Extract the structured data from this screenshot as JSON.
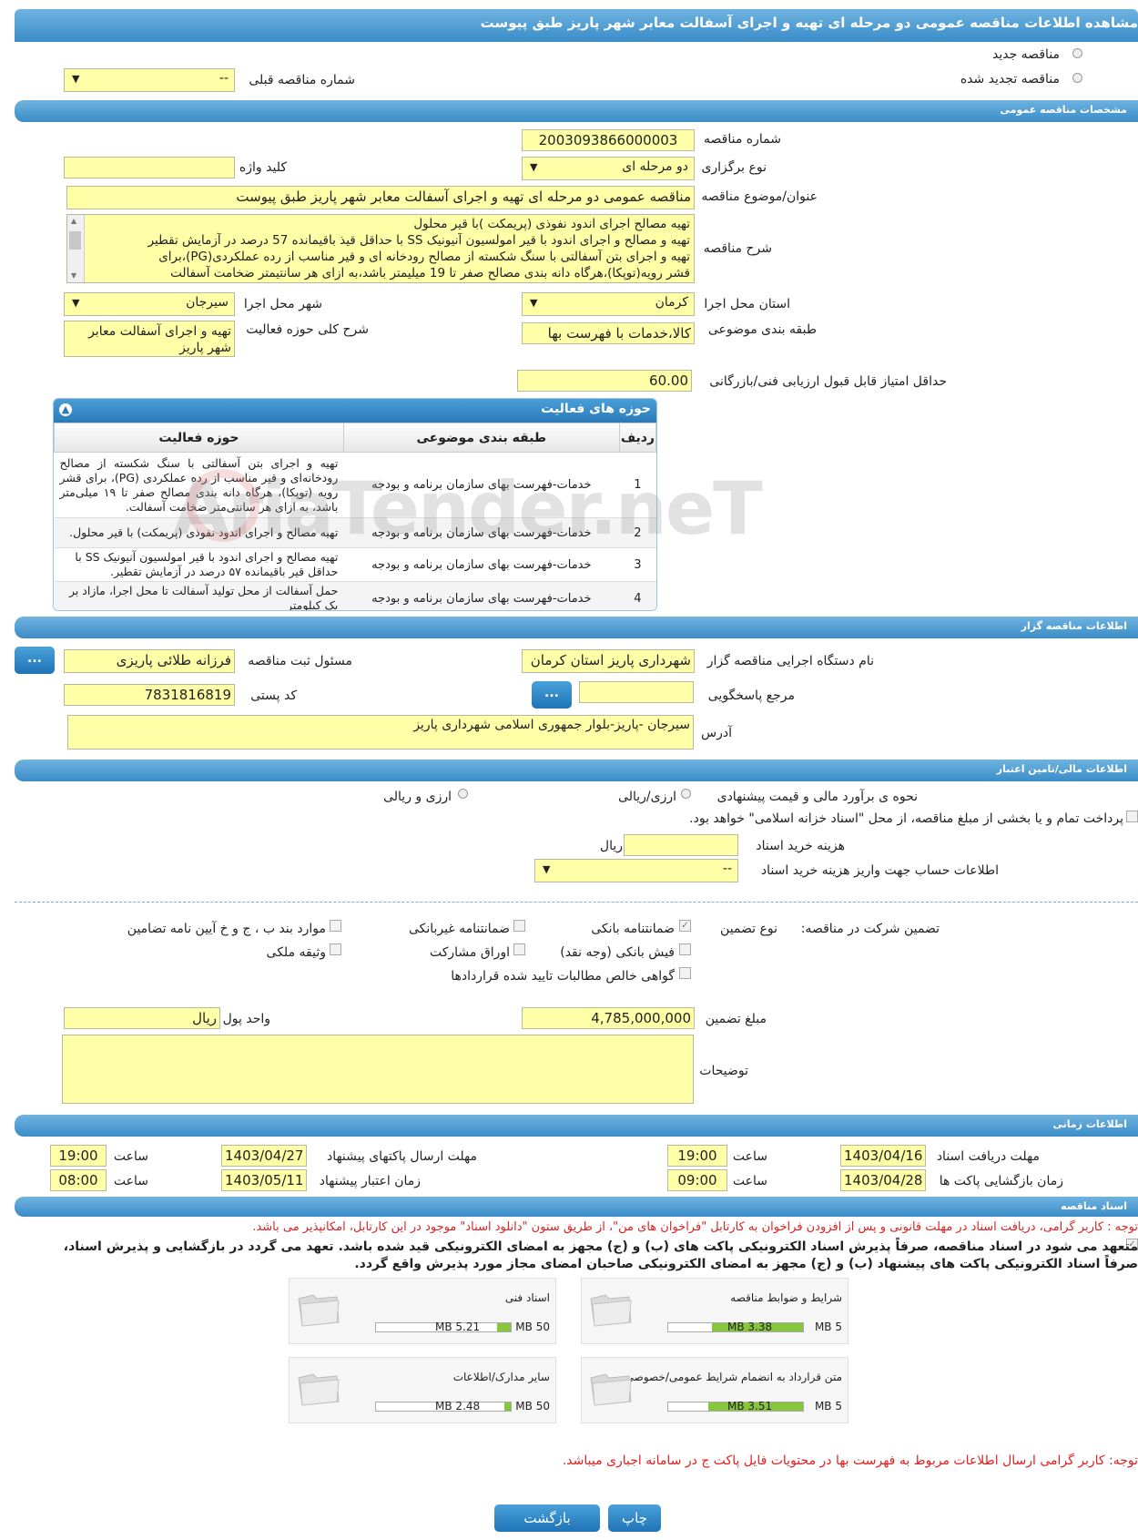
{
  "header_title": "مشاهده اطلاعات مناقصه عمومی دو مرحله ای تهیه و اجرای آسفالت معابر شهر پاریز طبق پیوست",
  "tender_type": {
    "new_label": "مناقصه جدید",
    "renewed_label": "مناقصه تجدید شده",
    "prev_number_label": "شماره مناقصه قبلی",
    "prev_number_value": "--"
  },
  "general": {
    "section_title": "مشخصات مناقصه عمومی",
    "tender_number_label": "شماره مناقصه",
    "tender_number": "2003093866000003",
    "holding_type_label": "نوع برگزاری",
    "holding_type": "دو مرحله ای",
    "keyword_label": "کلید واژه",
    "keyword": "",
    "subject_label": "عنوان/موضوع مناقصه",
    "subject": "مناقصه عمومی دو مرحله ای تهیه و اجرای آسفالت معابر شهر پاریز طبق پیوست",
    "description_label": "شرح مناقصه",
    "description_lines": [
      "تهیه مصالح   اجرای اندود نفوذی (پریمکت )با قیر محلول",
      "تهیه و مصالح و اجرای اندود با قیر امولسیون آنیونیک SS با حداقل قیذ باقیمانده 57 درصد در آزمایش تقطیر",
      "تهیه و اجرای بتن آسفالتی با سنگ شکسته از مصالح رودخانه ای و قیر مناسب از رده عملکردی(PG)،برای",
      "قشر رویه(توپکا)،هرگاه دانه بندی مصالح صفر تا 19 میلیمتر باشد،به ازای هر سانتیمتر ضخامت آسفالت"
    ],
    "province_label": "استان محل اجرا",
    "province": "کرمان",
    "city_label": "شهر محل اجرا",
    "city": "سیرجان",
    "category_label": "طبقه بندی موضوعی",
    "category": "کالا،خدمات با فهرست بها",
    "activity_desc_label": "شرح کلی حوزه فعالیت",
    "activity_desc": "تهیه و اجرای آسفالت معابر شهر پاریز",
    "min_score_label": "حداقل امتیاز قابل قبول ارزیابی فنی/بازرگانی",
    "min_score": "60.00"
  },
  "activity_table": {
    "title": "حوزه های فعالیت",
    "headers": [
      "ردیف",
      "طبقه بندی موضوعی",
      "حوزه فعالیت"
    ],
    "rows": [
      {
        "n": "1",
        "cat": "خدمات-فهرست بهای سازمان برنامه و بودجه",
        "act": "تهیه و اجرای بتن آسفالتی با سنگ شکسته از مصالح رودخانه‌ای و قیر مناسب از رده عملکردی (PG)، برای قشر رویه (توپکا)، هرگاه دانه بندی مصالح صفر تا ۱۹ میلی‌متر باشد، به ازای هر سانتی‌متر ضخامت آسفالت."
      },
      {
        "n": "2",
        "cat": "خدمات-فهرست بهای سازمان برنامه و بودجه",
        "act": "تهیه مصالح و اجرای اندود نفوذی (پریمکت) با قیر محلول."
      },
      {
        "n": "3",
        "cat": "خدمات-فهرست بهای سازمان برنامه و بودجه",
        "act": "تهیه مصالح و اجرای اندود با قیر امولسیون آنیونیک SS با حداقل قیر باقیمانده ۵۷ درصد در آزمایش تقطیر."
      },
      {
        "n": "4",
        "cat": "خدمات-فهرست بهای سازمان برنامه و بودجه",
        "act": "حمل آسفالت از محل تولید آسفالت تا محل اجرا، مازاد بر یک کیلومتر"
      }
    ]
  },
  "watermark": "AriaTender.neT",
  "organizer": {
    "section_title": "اطلاعات مناقصه گزار",
    "org_label": "نام دستگاه اجرایی مناقصه گزار",
    "org": "شهرداری پاریز استان کرمان",
    "responsible_label": "مسئول ثبت مناقصه",
    "responsible": "فرزانه طلائی پاریزی",
    "ref_label": "مرجع پاسخگویی",
    "ref": "",
    "postal_label": "کد پستی",
    "postal": "7831816819",
    "address_label": "آدرس",
    "address": "سیرجان -پاریز-بلوار جمهوری اسلامی شهرداری پاریز",
    "dots_button": "..."
  },
  "finance": {
    "section_title": "اطلاعات مالی/تامین اعتبار",
    "estimate_label": "نحوه ی برآورد مالی و قیمت پیشنهادی",
    "opt_rial": "ارزی/ریالی",
    "opt_currency": "ارزی و ریالی",
    "treasury_text": "پرداخت تمام و یا بخشی از مبلغ مناقصه، از محل \"اسناد خزانه اسلامی\" خواهد بود.",
    "doc_cost_label": "هزینه خرید اسناد",
    "doc_cost": "",
    "doc_cost_unit": "ریال",
    "account_label": "اطلاعات حساب جهت واریز هزینه خرید اسناد",
    "account": "--"
  },
  "guarantee": {
    "label": "تضمین شرکت در مناقصه:",
    "type_label": "نوع تضمین",
    "options": [
      {
        "label": "ضمانتنامه بانکی",
        "checked": true
      },
      {
        "label": "ضمانتنامه غیربانکی",
        "checked": false
      },
      {
        "label": "موارد بند ب ، ج و خ آیین نامه تضامین",
        "checked": false
      },
      {
        "label": "فیش بانکی (وجه نقد)",
        "checked": false
      },
      {
        "label": "اوراق مشارکت",
        "checked": false
      },
      {
        "label": "وثیقه ملکی",
        "checked": false
      },
      {
        "label": "گواهی خالص مطالبات تایید شده قراردادها",
        "checked": false
      }
    ],
    "amount_label": "مبلغ تضمین",
    "amount": "4,785,000,000",
    "currency_label": "واحد پول",
    "currency": "ریال",
    "notes_label": "توضیحات",
    "notes": ""
  },
  "timing": {
    "section_title": "اطلاعات زمانی",
    "doc_deadline_label": "مهلت دریافت اسناد",
    "doc_deadline_date": "1403/04/16",
    "doc_deadline_time": "19:00",
    "submit_deadline_label": "مهلت ارسال پاکتهای پیشنهاد",
    "submit_deadline_date": "1403/04/27",
    "submit_deadline_time": "19:00",
    "opening_label": "زمان بازگشایی پاکت ها",
    "opening_date": "1403/04/28",
    "opening_time": "09:00",
    "validity_label": "زمان اعتبار پیشنهاد",
    "validity_date": "1403/05/11",
    "validity_time": "08:00",
    "time_label": "ساعت"
  },
  "documents": {
    "section_title": "اسناد مناقصه",
    "note1": "توجه : کاربر گرامی، دریافت اسناد در مهلت قانونی و پس از افزودن فراخوان به کارتابل \"فراخوان های من\"، از طریق ستون \"دانلود اسناد\" موجود در این کارتابل، امکانپذیر می باشد.",
    "commit_line1": "متعهد می شود در اسناد مناقصه، صرفاً پذیرش اسناد الکترونیکی پاکت های (ب) و (ج) مجهز به امضای الکترونیکی قید شده باشد. تعهد می گردد در بازگشایی و پذیرش اسناد،",
    "commit_line2": "صرفاً اسناد الکترونیکی پاکت های پیشنهاد (ب) و (ج) مجهز به امضای الکترونیکی صاحبان امضای مجاز مورد پذیرش واقع گردد.",
    "cards": [
      {
        "name": "شرایط و ضوابط مناقصه",
        "size": "3.38 MB",
        "max": "5 MB",
        "fill": 0.676
      },
      {
        "name": "اسناد فنی",
        "size": "5.21 MB",
        "max": "50 MB",
        "fill": 0.104
      },
      {
        "name": "متن قرارداد به انضمام شرایط عمومی/خصوصی",
        "size": "3.51 MB",
        "max": "5 MB",
        "fill": 0.702
      },
      {
        "name": "سایر مدارک/اطلاعات",
        "size": "2.48 MB",
        "max": "50 MB",
        "fill": 0.05
      }
    ],
    "note2": "توجه: کاربر گرامی ارسال اطلاعات مربوط به فهرست بها در محتویات فایل پاکت ج در سامانه اجباری میباشد."
  },
  "buttons": {
    "print": "چاپ",
    "back": "بازگشت"
  },
  "colors": {
    "accent": "#3a8cc8",
    "field": "#ffffa8",
    "progress": "#86c53c",
    "warning": "#e02020"
  }
}
